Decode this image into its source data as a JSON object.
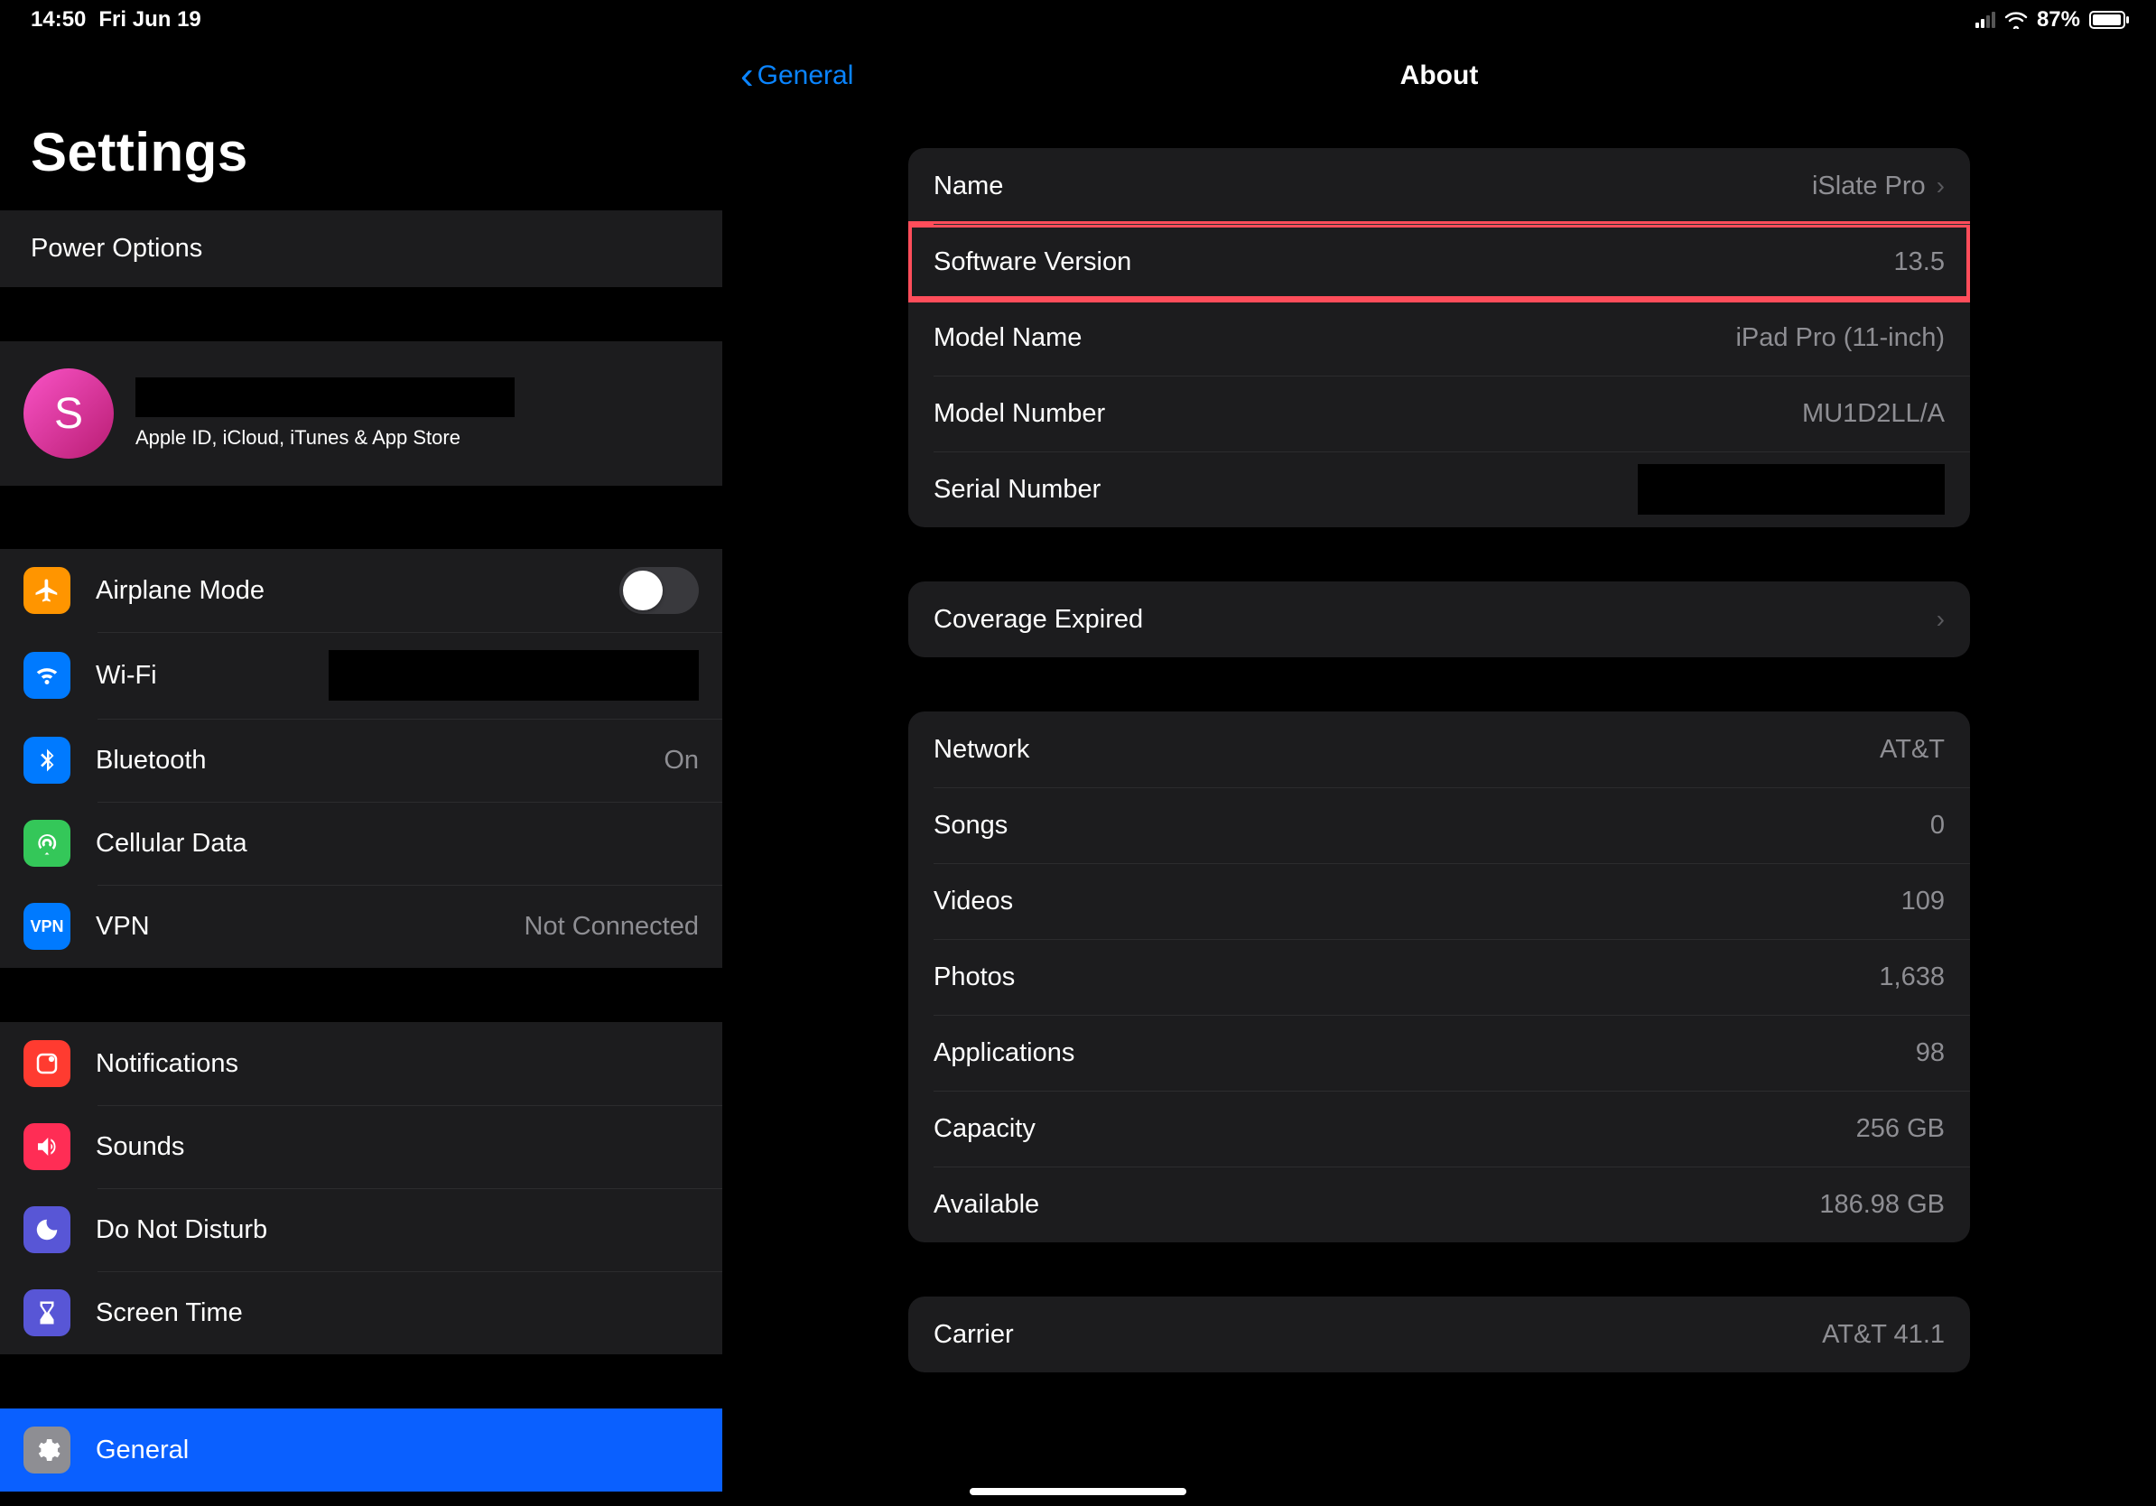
{
  "status": {
    "time": "14:50",
    "date": "Fri Jun 19",
    "battery_pct": "87%",
    "battery_fill_pct": 87
  },
  "sidebar": {
    "title": "Settings",
    "power": "Power Options",
    "apple_id_sub": "Apple ID, iCloud, iTunes & App Store",
    "avatar_initial": "S",
    "items": {
      "airplane": "Airplane Mode",
      "wifi": "Wi-Fi",
      "bluetooth": "Bluetooth",
      "bluetooth_val": "On",
      "cellular": "Cellular Data",
      "vpn": "VPN",
      "vpn_val": "Not Connected",
      "notifications": "Notifications",
      "sounds": "Sounds",
      "dnd": "Do Not Disturb",
      "screentime": "Screen Time",
      "general": "General"
    },
    "vpn_badge": "VPN"
  },
  "detail": {
    "back": "General",
    "title": "About",
    "g1": {
      "name_k": "Name",
      "name_v": "iSlate Pro",
      "sw_k": "Software Version",
      "sw_v": "13.5",
      "model_k": "Model Name",
      "model_v": "iPad Pro (11-inch)",
      "modelnum_k": "Model Number",
      "modelnum_v": "MU1D2LL/A",
      "serial_k": "Serial Number"
    },
    "g2": {
      "coverage_k": "Coverage Expired"
    },
    "g3": {
      "network_k": "Network",
      "network_v": "AT&T",
      "songs_k": "Songs",
      "songs_v": "0",
      "videos_k": "Videos",
      "videos_v": "109",
      "photos_k": "Photos",
      "photos_v": "1,638",
      "apps_k": "Applications",
      "apps_v": "98",
      "capacity_k": "Capacity",
      "capacity_v": "256 GB",
      "available_k": "Available",
      "available_v": "186.98 GB"
    },
    "g4": {
      "carrier_k": "Carrier",
      "carrier_v": "AT&T 41.1"
    }
  }
}
